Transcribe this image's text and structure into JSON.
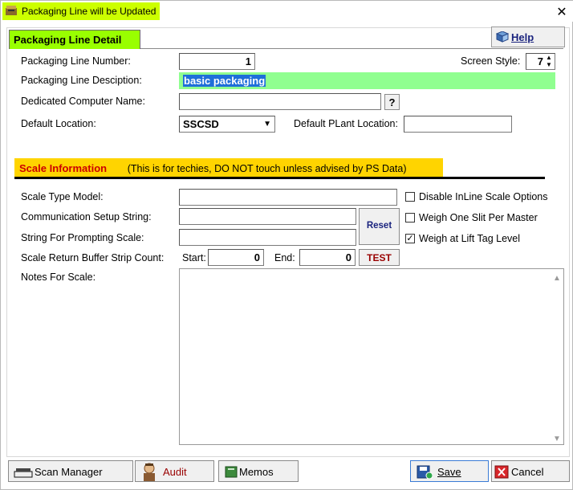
{
  "window": {
    "title": "Packaging Line will be Updated",
    "close_glyph": "✕"
  },
  "tab": {
    "label": "Packaging Line Detail"
  },
  "help": {
    "label": "Help"
  },
  "fields": {
    "line_number_label": "Packaging Line Number:",
    "line_number_value": "1",
    "screen_style_label": "Screen Style:",
    "screen_style_value": "7",
    "description_label": "Packaging Line Desciption:",
    "description_value": "basic packaging",
    "computer_label": "Dedicated Computer Name:",
    "computer_value": "",
    "computer_lookup": "?",
    "location_label": "Default Location:",
    "location_value": "SSCSD",
    "plant_location_label": "Default PLant Location:",
    "plant_location_value": ""
  },
  "scale": {
    "title": "Scale Information",
    "note": "(This is for techies, DO NOT touch unless advised by PS Data)",
    "type_label": "Scale Type Model:",
    "type_value": "",
    "comm_label": "Communication Setup String:",
    "comm_value": "",
    "prompt_label": "String For Prompting Scale:",
    "prompt_value": "",
    "reset_label": "Reset",
    "strip_label": "Scale Return Buffer Strip Count:",
    "start_label": "Start:",
    "start_value": "0",
    "end_label": "End:",
    "end_value": "0",
    "test_label": "TEST",
    "notes_label": "Notes For Scale:",
    "notes_value": "",
    "options": [
      {
        "label": "Disable InLine Scale Options",
        "checked": false
      },
      {
        "label": "Weigh One Slit Per Master",
        "checked": false
      },
      {
        "label": "Weigh at Lift Tag Level",
        "checked": true
      }
    ]
  },
  "bottom": {
    "scan_manager": "Scan Manager",
    "audit": "Audit",
    "memos": "Memos",
    "save": "Save",
    "cancel": "Cancel"
  },
  "colors": {
    "title_highlight": "#ccff00",
    "tab_bg": "#99ff00",
    "description_bg": "#90ff90",
    "scale_header_bg": "#ffd400",
    "scale_title_text": "#cc0000",
    "test_text": "#990000",
    "reset_text": "#1a237e",
    "audit_text": "#990000"
  }
}
